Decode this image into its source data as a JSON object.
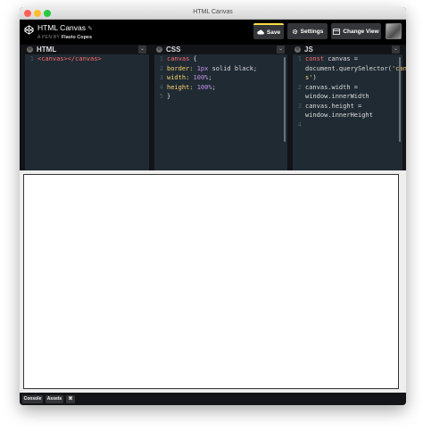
{
  "window": {
    "title": "HTML Canvas"
  },
  "header": {
    "pen_title": "HTML Canvas",
    "by_label": "A PEN BY",
    "author": "Flavio Copes",
    "save_label": "Save",
    "settings_label": "Settings",
    "change_view_label": "Change View",
    "accent_color": "#ffdd40"
  },
  "editors": {
    "html": {
      "title": "HTML",
      "lines": [
        {
          "n": "1",
          "parts": [
            {
              "t": "<canvas></canvas>",
              "c": "#ff6b6b"
            }
          ]
        }
      ]
    },
    "css": {
      "title": "CSS",
      "lines": [
        {
          "n": "1",
          "parts": [
            {
              "t": "canvas ",
              "c": "#ff6b6b"
            },
            {
              "t": "{",
              "c": "#dddddd"
            }
          ]
        },
        {
          "n": "2",
          "parts": [
            {
              "t": "  border: ",
              "c": "#ffd36b"
            },
            {
              "t": "1px ",
              "c": "#c792ea"
            },
            {
              "t": "solid black;",
              "c": "#dddddd"
            }
          ]
        },
        {
          "n": "3",
          "parts": [
            {
              "t": "  width: ",
              "c": "#ffd36b"
            },
            {
              "t": "100%",
              "c": "#c792ea"
            },
            {
              "t": ";",
              "c": "#dddddd"
            }
          ]
        },
        {
          "n": "4",
          "parts": [
            {
              "t": "  height: ",
              "c": "#ffd36b"
            },
            {
              "t": "100%",
              "c": "#c792ea"
            },
            {
              "t": ";",
              "c": "#dddddd"
            }
          ]
        },
        {
          "n": "5",
          "parts": [
            {
              "t": "}",
              "c": "#dddddd"
            }
          ]
        }
      ]
    },
    "js": {
      "title": "JS",
      "lines": [
        {
          "n": "1",
          "parts": [
            {
              "t": "const ",
              "c": "#ff6b6b"
            },
            {
              "t": "canvas =",
              "c": "#dddddd"
            }
          ]
        },
        {
          "n": "",
          "parts": [
            {
              "t": "document.querySelector(",
              "c": "#dddddd"
            },
            {
              "t": "'canva",
              "c": "#ffd36b"
            }
          ]
        },
        {
          "n": "",
          "parts": [
            {
              "t": "s'",
              "c": "#ffd36b"
            },
            {
              "t": ")",
              "c": "#dddddd"
            }
          ]
        },
        {
          "n": "2",
          "parts": [
            {
              "t": "canvas.width =",
              "c": "#dddddd"
            }
          ]
        },
        {
          "n": "",
          "parts": [
            {
              "t": "window.innerWidth",
              "c": "#dddddd"
            }
          ]
        },
        {
          "n": "3",
          "parts": [
            {
              "t": "canvas.height =",
              "c": "#dddddd"
            }
          ]
        },
        {
          "n": "",
          "parts": [
            {
              "t": "window.innerHeight",
              "c": "#dddddd"
            }
          ]
        },
        {
          "n": "4",
          "parts": []
        }
      ]
    }
  },
  "footer": {
    "console_label": "Console",
    "assets_label": "Assets",
    "shortcuts_label": "⌘"
  }
}
